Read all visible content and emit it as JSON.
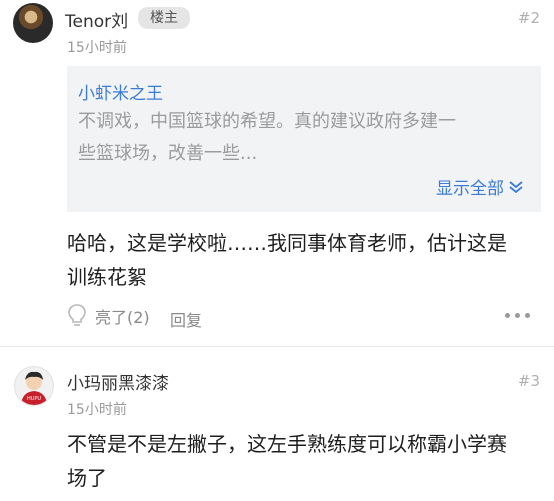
{
  "posts": [
    {
      "author": "Tenor刘",
      "badge": "楼主",
      "floor": "#2",
      "time": "15小时前",
      "quote": {
        "author": "小虾米之王",
        "line1": "不调戏，中国篮球的希望。真的建议政府多建一",
        "line2": "些篮球场，改善一些...",
        "show_all": "显示全部"
      },
      "content_line1": "哈哈，这是学校啦……我同事体育老师，估计这是",
      "content_line2": "训练花絮",
      "like_label": "亮了(2)",
      "reply_label": "回复"
    },
    {
      "author": "小玛丽黑漆漆",
      "floor": "#3",
      "time": "15小时前",
      "avatar_text": "HUPU",
      "content_line1": "不管是不是左撇子，这左手熟练度可以称霸小学赛",
      "content_line2": "场了"
    }
  ],
  "colors": {
    "link": "#3a7bd5",
    "quote_bg": "#f2f3f5",
    "muted": "#9a9a9a"
  }
}
